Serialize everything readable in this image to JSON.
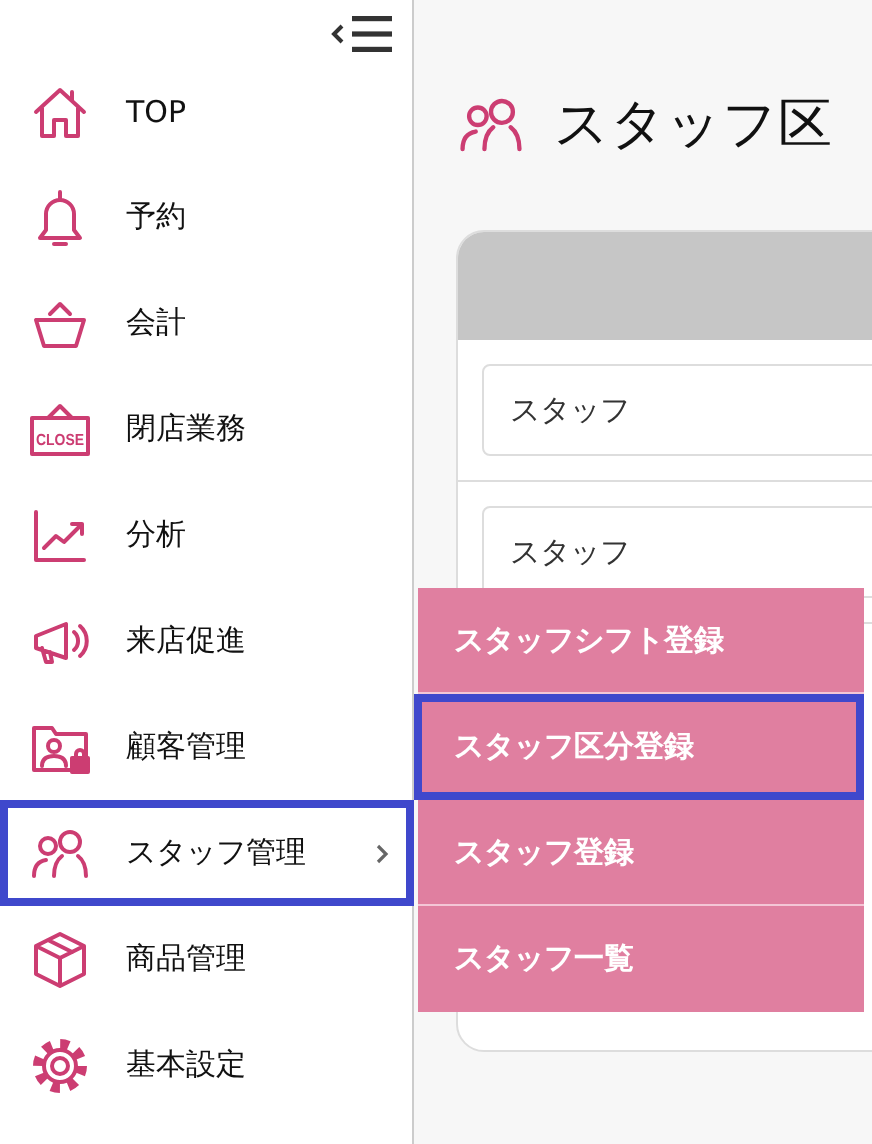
{
  "sidebar": {
    "items": [
      {
        "label": "TOP",
        "kind": "home",
        "selected": false,
        "has_submenu": false
      },
      {
        "label": "予約",
        "kind": "bell",
        "selected": false,
        "has_submenu": false
      },
      {
        "label": "会計",
        "kind": "basket",
        "selected": false,
        "has_submenu": false
      },
      {
        "label": "閉店業務",
        "kind": "close-sign",
        "icon_text": "CLOSE",
        "selected": false,
        "has_submenu": false
      },
      {
        "label": "分析",
        "kind": "chart",
        "selected": false,
        "has_submenu": false
      },
      {
        "label": "来店促進",
        "kind": "megaphone",
        "selected": false,
        "has_submenu": false
      },
      {
        "label": "顧客管理",
        "kind": "folder-user",
        "selected": false,
        "has_submenu": false
      },
      {
        "label": "スタッフ管理",
        "kind": "people",
        "selected": true,
        "has_submenu": true
      },
      {
        "label": "商品管理",
        "kind": "box",
        "selected": false,
        "has_submenu": false
      },
      {
        "label": "基本設定",
        "kind": "gear",
        "selected": false,
        "has_submenu": false
      }
    ]
  },
  "page": {
    "title": "スタッフ区"
  },
  "card": {
    "rows": [
      {
        "value": "スタッフ"
      },
      {
        "value": "スタッフ"
      }
    ]
  },
  "submenu": {
    "items": [
      {
        "label": "スタッフシフト登録",
        "selected": false
      },
      {
        "label": "スタッフ区分登録",
        "selected": true
      },
      {
        "label": "スタッフ登録",
        "selected": false
      },
      {
        "label": "スタッフ一覧",
        "selected": false
      }
    ]
  }
}
